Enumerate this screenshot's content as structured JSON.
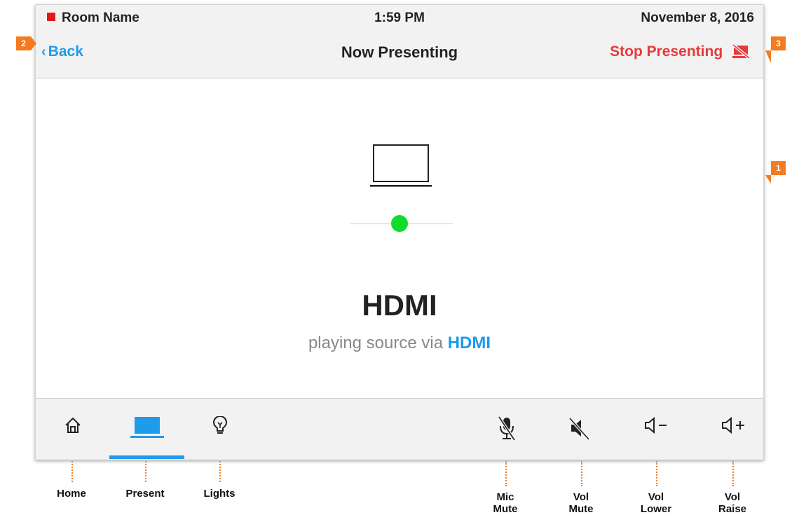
{
  "status_bar": {
    "room_name": "Room Name",
    "time": "1:59 PM",
    "date": "November 8, 2016",
    "room_indicator_color": "#e01a1a"
  },
  "nav_bar": {
    "back_label": "Back",
    "title": "Now Presenting",
    "stop_label": "Stop Presenting"
  },
  "source": {
    "device_icon": "laptop-icon",
    "status_color": "#12dc29",
    "title": "HDMI",
    "subtitle_prefix": "playing source via",
    "subtitle_source": "HDMI"
  },
  "bottom_nav": {
    "left": [
      "home-icon",
      "present-icon",
      "lights-icon"
    ],
    "right": [
      "mic-mute-icon",
      "vol-mute-icon",
      "vol-lower-icon",
      "vol-raise-icon"
    ],
    "active": "Present"
  },
  "callouts": {
    "one": "1",
    "two": "2",
    "three": "3",
    "color": "#f47b20"
  },
  "labels": {
    "home": "Home",
    "present": "Present",
    "lights": "Lights",
    "mic_mute": [
      "Mic",
      "Mute"
    ],
    "vol_mute": [
      "Vol",
      "Mute"
    ],
    "vol_lower": [
      "Vol",
      "Lower"
    ],
    "vol_raise": [
      "Vol",
      "Raise"
    ]
  },
  "colors": {
    "accent": "#1e9bea",
    "stop": "#e83a3a",
    "bar_bg": "#f2f2f2"
  }
}
